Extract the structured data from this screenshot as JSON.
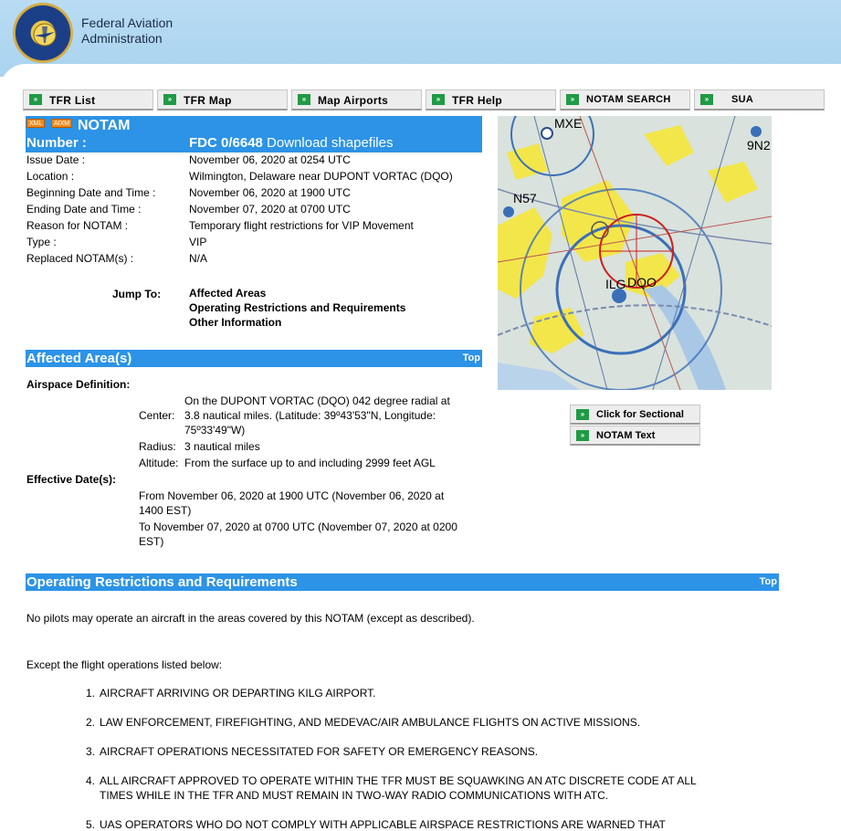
{
  "header": {
    "agency_line1": "Federal Aviation",
    "agency_line2": "Administration",
    "logo_icon": "faa-seal-icon"
  },
  "nav": {
    "go_glyph": "»",
    "tabs": [
      {
        "label": "TFR List"
      },
      {
        "label": "TFR Map"
      },
      {
        "label": "Map Airports"
      },
      {
        "label": "TFR Help"
      },
      {
        "label": "NOTAM SEARCH"
      },
      {
        "label": "SUA"
      }
    ]
  },
  "notam": {
    "badge_xml": "XML",
    "badge_aixm": "AIXM",
    "title": "NOTAM",
    "number_label": "Number :",
    "number_value": "FDC 0/6648",
    "download_link": "Download shapefiles",
    "fields": [
      {
        "label": "Issue Date :",
        "value": "November 06, 2020 at 0254 UTC"
      },
      {
        "label": "Location :",
        "value": "Wilmington, Delaware near DUPONT VORTAC (DQO)"
      },
      {
        "label": "Beginning Date and Time :",
        "value": "November 06, 2020 at 1900 UTC"
      },
      {
        "label": "Ending Date and Time :",
        "value": "November 07, 2020 at 0700 UTC"
      },
      {
        "label": "Reason for NOTAM :",
        "value": "Temporary flight restrictions for VIP Movement"
      },
      {
        "label": "Type :",
        "value": "VIP"
      },
      {
        "label": "Replaced NOTAM(s) :",
        "value": "N/A"
      }
    ],
    "jump_label": "Jump To:",
    "jump_links": [
      "Affected Areas",
      "Operating Restrictions and Requirements",
      "Other Information"
    ]
  },
  "affected": {
    "title": "Affected Area(s)",
    "top_link": "Top",
    "airspace_label": "Airspace Definition:",
    "center_label": "Center:",
    "center_l1": "On the DUPONT VORTAC (DQO) 042 degree radial at",
    "center_l2": "3.8 nautical miles. (Latitude: 39º43'53\"N, Longitude:",
    "center_l3": "75º33'49\"W)",
    "radius_label": "Radius:",
    "radius_value": "3 nautical miles",
    "altitude_label": "Altitude:",
    "altitude_value": "From the surface up to and including 2999 feet AGL",
    "effective_label": "Effective Date(s):",
    "from_l1": "From November 06, 2020 at 1900 UTC (November 06, 2020 at",
    "from_l2": "1400 EST)",
    "to_l1": "To November 07, 2020 at 0700 UTC (November 07, 2020 at 0200",
    "to_l2": "EST)"
  },
  "map": {
    "labels": {
      "mxe": "MXE",
      "n9": "9N2",
      "n57": "N57",
      "ilg": "ILG",
      "dqo": "DQO"
    }
  },
  "side_buttons": {
    "sectional": "Click for Sectional",
    "notam_text": "NOTAM Text"
  },
  "operating": {
    "title": "Operating Restrictions and Requirements",
    "top_link": "Top",
    "para1": "No pilots may operate an aircraft in the areas covered by this NOTAM (except as described).",
    "para2": "Except the flight operations listed below:",
    "items": [
      {
        "n": "1.",
        "l1": "AIRCRAFT ARRIVING OR DEPARTING KILG AIRPORT.",
        "l2": ""
      },
      {
        "n": "2.",
        "l1": "LAW ENFORCEMENT, FIREFIGHTING, AND MEDEVAC/AIR AMBULANCE FLIGHTS ON ACTIVE MISSIONS.",
        "l2": ""
      },
      {
        "n": "3.",
        "l1": "AIRCRAFT OPERATIONS NECESSITATED FOR SAFETY OR EMERGENCY REASONS.",
        "l2": ""
      },
      {
        "n": "4.",
        "l1": "ALL AIRCRAFT APPROVED TO OPERATE WITHIN THE TFR MUST BE SQUAWKING AN ATC DISCRETE CODE AT ALL",
        "l2": "TIMES WHILE IN THE TFR AND MUST REMAIN IN TWO-WAY RADIO COMMUNICATIONS WITH ATC."
      },
      {
        "n": "5.",
        "l1": "UAS OPERATORS WHO DO NOT COMPLY WITH APPLICABLE AIRSPACE RESTRICTIONS ARE WARNED THAT",
        "l2": ""
      }
    ]
  }
}
